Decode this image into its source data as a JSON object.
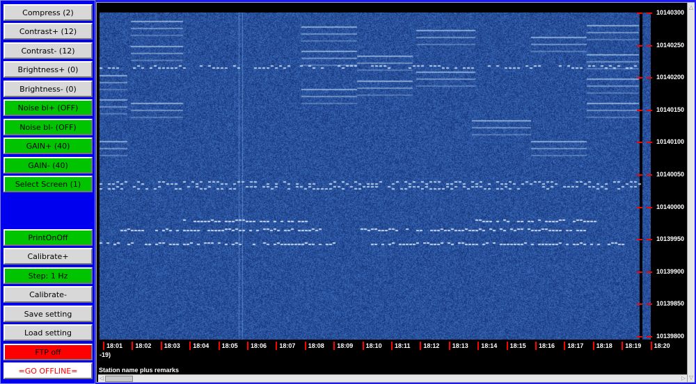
{
  "sidebar": {
    "buttons": [
      {
        "label": "Compress (2)",
        "color": "grey"
      },
      {
        "label": "Contrast+ (12)",
        "color": "grey"
      },
      {
        "label": "Contrast- (12)",
        "color": "grey"
      },
      {
        "label": "Brightness+ (0)",
        "color": "grey"
      },
      {
        "label": "Brightness- (0)",
        "color": "grey"
      },
      {
        "label": "Noise bl+ (OFF)",
        "color": "green"
      },
      {
        "label": "Noise bl- (OFF)",
        "color": "green"
      },
      {
        "label": "GAIN+ (40)",
        "color": "green"
      },
      {
        "label": "GAIN- (40)",
        "color": "green"
      },
      {
        "label": "Select Screen (1)",
        "color": "green"
      },
      {
        "label": "PrintOnOff",
        "color": "green"
      },
      {
        "label": "Calibrate+",
        "color": "grey"
      },
      {
        "label": "Step: 1 Hz",
        "color": "green"
      },
      {
        "label": "Calibrate-",
        "color": "grey"
      },
      {
        "label": "Save setting",
        "color": "grey"
      },
      {
        "label": "Load setting",
        "color": "grey"
      },
      {
        "label": "FTP off",
        "color": "red"
      },
      {
        "label": "=GO OFFLINE=",
        "color": "white"
      }
    ]
  },
  "waterfall": {
    "freq_labels": [
      "10140300",
      "10140250",
      "10140200",
      "10140150",
      "10140100",
      "10140050",
      "10140000",
      "10139950",
      "10139900",
      "10139850",
      "10139800"
    ],
    "time_labels": [
      "18:01",
      "18:02",
      "18:03",
      "18:04",
      "18:05",
      "18:06",
      "18:07",
      "18:08",
      "18:09",
      "18:10",
      "18:11",
      "18:12",
      "18:13",
      "18:14",
      "18:15",
      "18:16",
      "18:17",
      "18:18",
      "18:19",
      "18:20"
    ],
    "note": "-19)",
    "station": "Station name plus remarks"
  }
}
